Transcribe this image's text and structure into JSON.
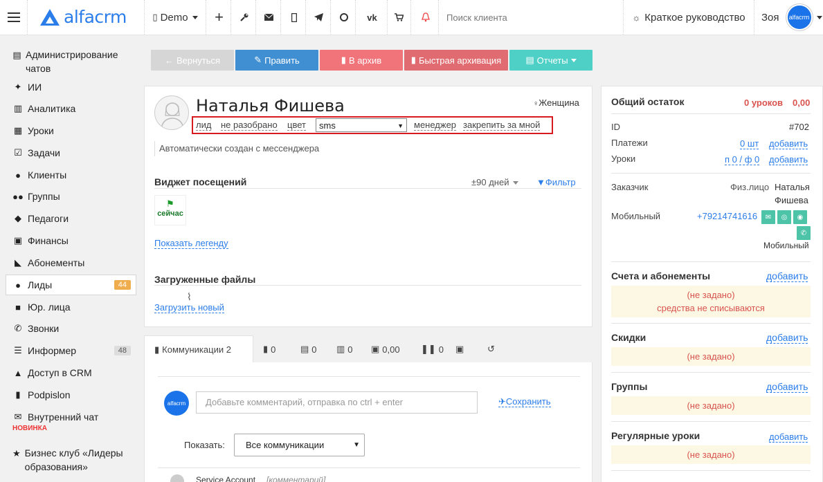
{
  "topbar": {
    "logo_text": "alfacrm",
    "branch": "Demo",
    "search_placeholder": "Поиск клиента",
    "guide": "Краткое руководство",
    "user_name": "Зоя",
    "avatar_text": "alfacrm"
  },
  "sidebar": {
    "items": [
      {
        "label": "Администрирование чатов",
        "icon": "chat-admin-icon"
      },
      {
        "label": "ИИ",
        "icon": "sparkle-icon"
      },
      {
        "label": "Аналитика",
        "icon": "map-icon"
      },
      {
        "label": "Уроки",
        "icon": "calendar-icon"
      },
      {
        "label": "Задачи",
        "icon": "tasks-icon"
      },
      {
        "label": "Клиенты",
        "icon": "user-icon"
      },
      {
        "label": "Группы",
        "icon": "users-icon"
      },
      {
        "label": "Педагоги",
        "icon": "graduation-cap-icon"
      },
      {
        "label": "Финансы",
        "icon": "money-icon"
      },
      {
        "label": "Абонементы",
        "icon": "tag-icon"
      },
      {
        "label": "Лиды",
        "icon": "user-plus-icon",
        "badge": "44"
      },
      {
        "label": "Юр. лица",
        "icon": "briefcase-icon"
      },
      {
        "label": "Звонки",
        "icon": "phone-icon"
      },
      {
        "label": "Информер",
        "icon": "list-icon",
        "badge": "48"
      },
      {
        "label": "Доступ в CRM",
        "icon": "lock-icon"
      },
      {
        "label": "Podpislon",
        "icon": "file-icon"
      },
      {
        "label": "Внутренний чат",
        "icon": "envelope-icon",
        "sub": "НОВИНКА"
      },
      {
        "label": "Бизнес клуб «Лидеры образования»",
        "icon": "star-icon"
      }
    ]
  },
  "actions": {
    "back": "Вернуться",
    "edit": "Править",
    "archive": "В архив",
    "quick_archive": "Быстрая архивация",
    "reports": "Отчеты"
  },
  "profile": {
    "name": "Наталья Фишева",
    "gender": "Женщина",
    "links": {
      "lead": "лид",
      "status": "не разобрано",
      "color": "цвет",
      "manager": "менеджер",
      "pin": "закрепить за мной"
    },
    "source_value": "sms",
    "note": "Автоматически создан с мессенджера"
  },
  "visits": {
    "title": "Виджет посещений",
    "range": "±90 дней",
    "filter": "Фильтр",
    "now_label": "сейчас",
    "legend_link": "Показать легенду"
  },
  "files": {
    "title": "Загруженные файлы",
    "upload": "Загрузить новый"
  },
  "tabs": {
    "communications": "Коммуникации 2",
    "t1": "0",
    "t2": "0",
    "t3": "0",
    "t4": "0,00",
    "t5": "0"
  },
  "comments": {
    "avatar_text": "alfacrm",
    "placeholder": "Добавьте комментарий, отправка по ctrl + enter",
    "save": "Сохранить",
    "show_label": "Показать:",
    "show_value": "Все коммуникации",
    "entry_author": "Service Account",
    "entry_type": "[комментарий]"
  },
  "right_panel": {
    "balance_title": "Общий остаток",
    "balance_lessons": "0 уроков",
    "balance_amount": "0,00",
    "id_label": "ID",
    "id_value": "#702",
    "payments_label": "Платежи",
    "payments_value": "0 шт",
    "lessons_label": "Уроки",
    "lessons_value": "п 0 / ф 0",
    "add": "добавить",
    "customer_label": "Заказчик",
    "customer_type": "Физ.лицо",
    "customer_first": "Наталья",
    "customer_last": "Фишева",
    "mobile_label": "Мобильный",
    "mobile_value": "+79214741616",
    "mobile_sub": "Мобильный",
    "accounts_title": "Счета и абонементы",
    "not_set": "(не задано)",
    "no_charge": "средства не списываются",
    "discounts_title": "Скидки",
    "groups_title": "Группы",
    "regular_title": "Регулярные уроки"
  }
}
